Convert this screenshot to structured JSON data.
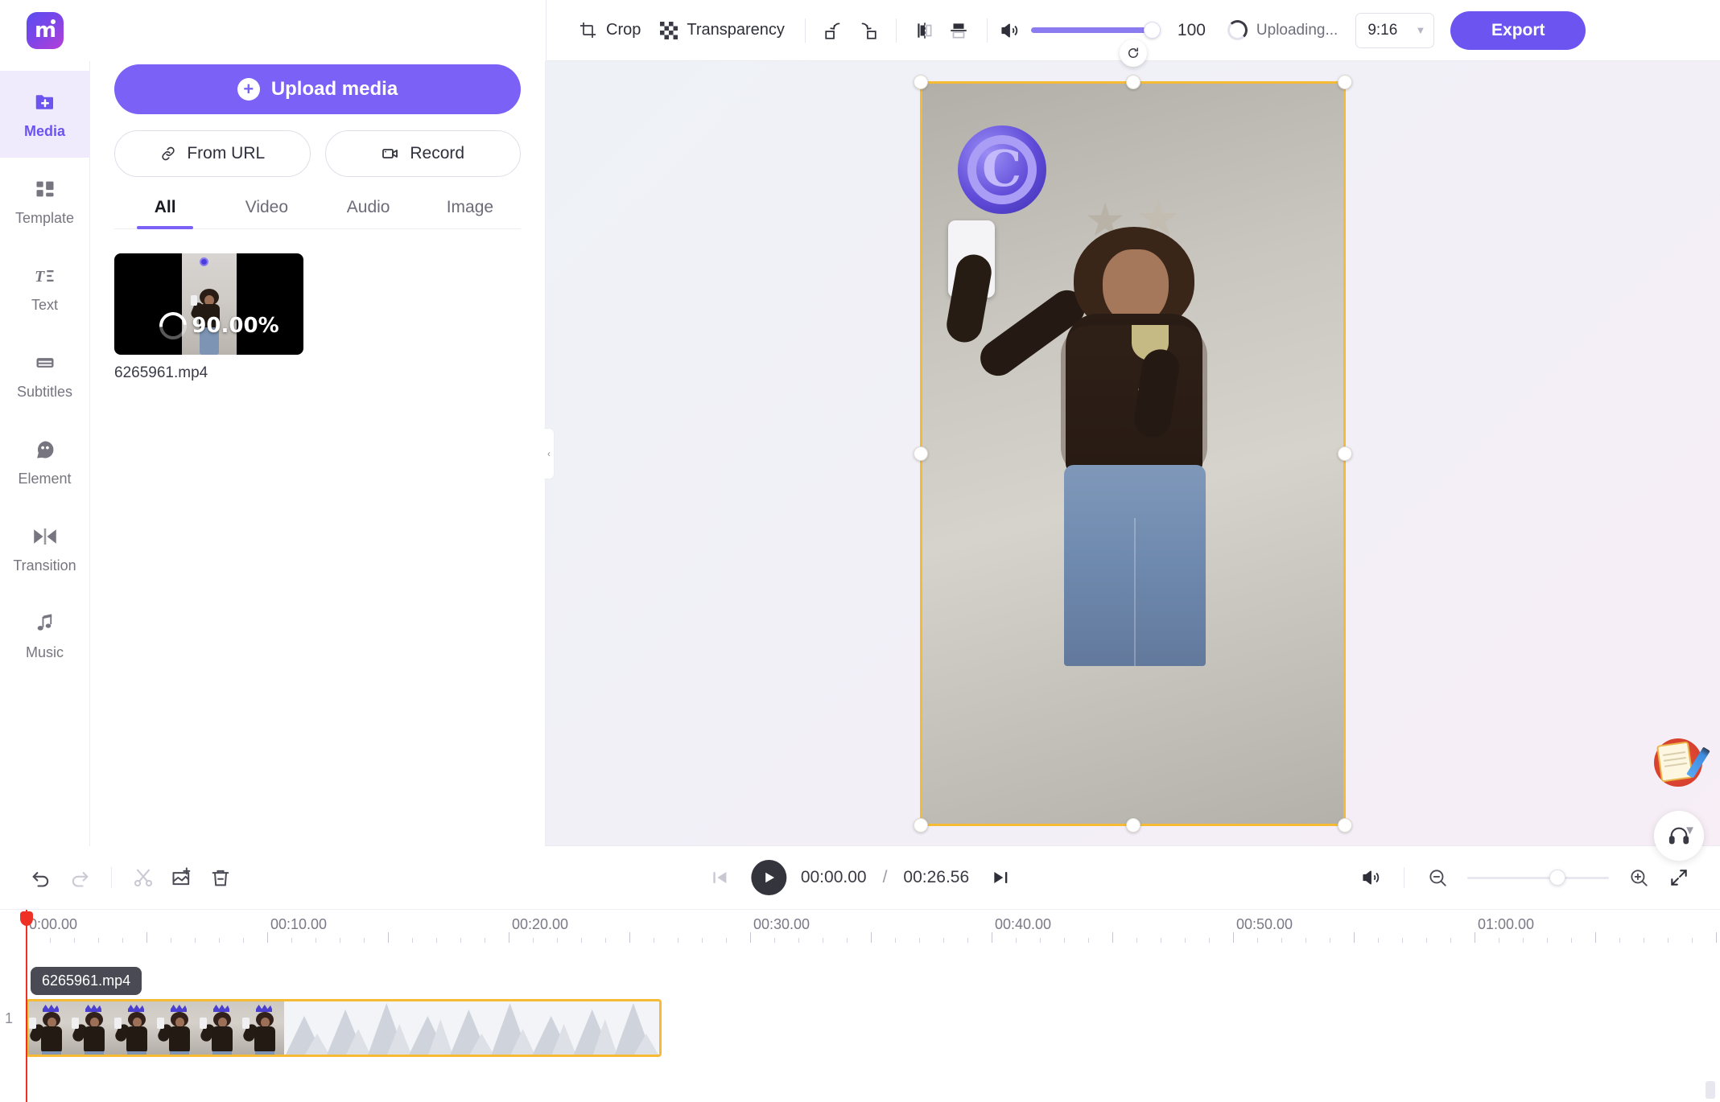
{
  "app": {
    "logo_letter": "m"
  },
  "toolbar": {
    "crop_label": "Crop",
    "transparency_label": "Transparency",
    "rotate_left_icon": "rotate-left-icon",
    "rotate_right_icon": "rotate-right-icon",
    "flip_horizontal_icon": "flip-horizontal-icon",
    "flip_vertical_icon": "flip-vertical-icon",
    "volume_icon": "volume-icon",
    "volume_value": "100",
    "upload_status": "Uploading...",
    "aspect_ratio": "9:16",
    "export_label": "Export"
  },
  "rail": {
    "items": [
      {
        "label": "Media",
        "icon": "media-folder-icon",
        "active": true
      },
      {
        "label": "Template",
        "icon": "template-icon",
        "active": false
      },
      {
        "label": "Text",
        "icon": "text-icon",
        "active": false
      },
      {
        "label": "Subtitles",
        "icon": "subtitles-icon",
        "active": false
      },
      {
        "label": "Element",
        "icon": "element-icon",
        "active": false
      },
      {
        "label": "Transition",
        "icon": "transition-icon",
        "active": false
      },
      {
        "label": "Music",
        "icon": "music-note-icon",
        "active": false
      }
    ]
  },
  "panel": {
    "upload_label": "Upload media",
    "from_url_label": "From URL",
    "record_label": "Record",
    "tabs": [
      {
        "label": "All",
        "active": true
      },
      {
        "label": "Video",
        "active": false
      },
      {
        "label": "Audio",
        "active": false
      },
      {
        "label": "Image",
        "active": false
      }
    ],
    "media": [
      {
        "name": "6265961.mp4",
        "progress": "90.00%"
      }
    ]
  },
  "canvas": {
    "aspect": "9:16",
    "rotate_handle_icon": "rotate-handle-icon",
    "note_widget_icon": "notepad-pencil-icon",
    "support_widget_icon": "headset-icon"
  },
  "timeline": {
    "undo_icon": "undo-icon",
    "redo_icon": "redo-icon",
    "split_icon": "scissors-icon",
    "add_media_icon": "add-image-icon",
    "delete_icon": "trash-icon",
    "prev_frame_icon": "skip-previous-icon",
    "play_icon": "play-icon",
    "next_frame_icon": "skip-next-icon",
    "current_time": "00:00.00",
    "time_separator": "/",
    "total_time": "00:26.56",
    "mute_icon": "volume-icon",
    "zoom_out_icon": "zoom-out-icon",
    "zoom_in_icon": "zoom-in-icon",
    "fit_icon": "fit-screen-icon",
    "ruler_labels": [
      "0:00.00",
      "00:10.00",
      "00:20.00",
      "00:30.00",
      "00:40.00",
      "00:50.00",
      "01:00.00"
    ],
    "track_number": "1",
    "clip_label": "6265961.mp4"
  }
}
